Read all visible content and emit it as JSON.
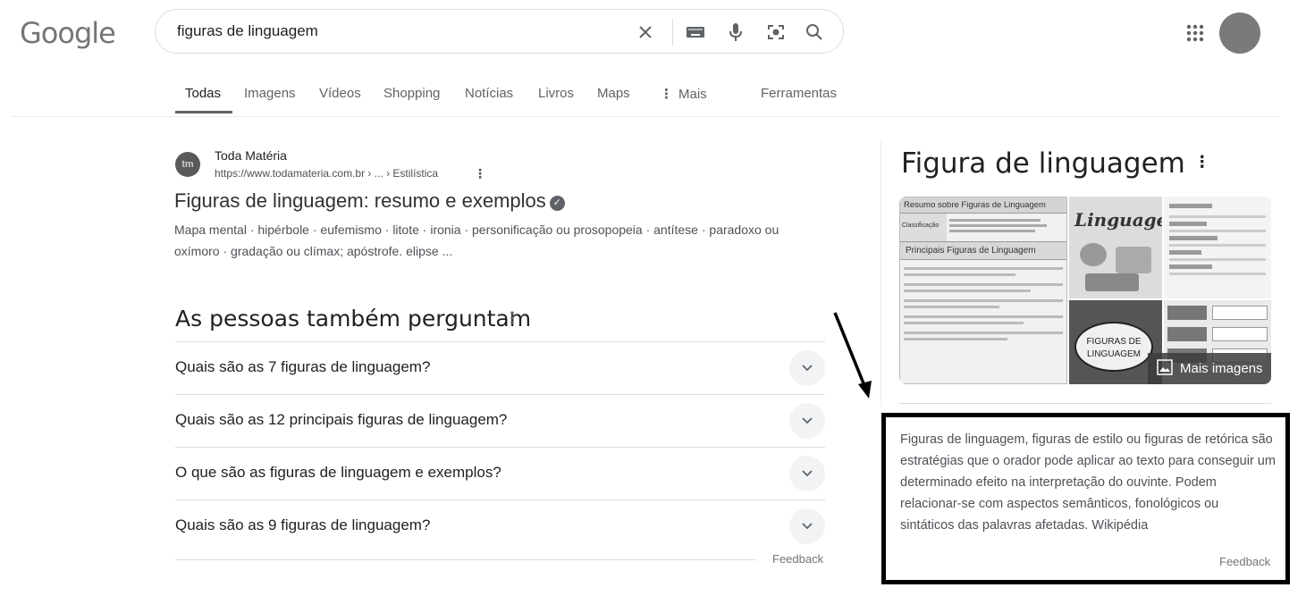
{
  "logo": "Google",
  "search": {
    "query": "figuras de linguagem"
  },
  "tabs": [
    {
      "label": "Todas",
      "active": true
    },
    {
      "label": "Imagens"
    },
    {
      "label": "Vídeos"
    },
    {
      "label": "Shopping"
    },
    {
      "label": "Notícias"
    },
    {
      "label": "Livros"
    },
    {
      "label": "Maps"
    },
    {
      "label": "Mais"
    },
    {
      "label": "Ferramentas"
    }
  ],
  "result": {
    "favicon_text": "tm",
    "site_name": "Toda Matéria",
    "url": "https://www.todamateria.com.br › ... › Estilística",
    "title": "Figuras de linguagem: resumo e exemplos",
    "snippet": "Mapa mental · hipérbole · eufemismo · litote · ironia · personificação ou prosopopeia · antítese · paradoxo ou oxímoro · gradação ou clímax; apóstrofe. elipse ..."
  },
  "paa": {
    "title": "As pessoas também perguntam",
    "questions": [
      "Quais são as 7 figuras de linguagem?",
      "Quais são as 12 principais figuras de linguagem?",
      "O que são as figuras de linguagem e exemplos?",
      "Quais são as 9 figuras de linguagem?"
    ],
    "feedback": "Feedback"
  },
  "knowledge_panel": {
    "title": "Figura de linguagem",
    "images": {
      "img1_title": "Resumo sobre Figuras de Linguagem",
      "img1_row": "Classificação",
      "img1_subtitle": "Principais Figuras de Linguagem",
      "img2_title": "Linguagem",
      "img4_text": "FIGURAS DE LINGUAGEM",
      "more_label": "Mais imagens"
    },
    "description": "Figuras de linguagem, figuras de estilo ou figuras de retórica são estratégias que o orador pode aplicar ao texto para conseguir um determinado efeito na interpretação do ouvinte. Podem relacionar-se com aspectos semânticos, fonológicos ou sintáticos das palavras afetadas.",
    "source": "Wikipédia",
    "feedback": "Feedback"
  }
}
